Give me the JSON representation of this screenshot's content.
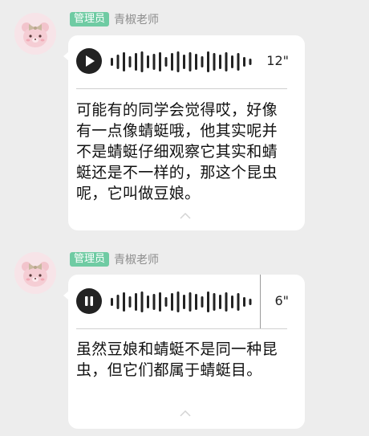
{
  "colors": {
    "background": "#ededed",
    "badge": "#6fcba3",
    "bubble": "#ffffff",
    "sender": "#8d8d8d"
  },
  "messages": [
    {
      "badge": "管理员",
      "sender": "青椒老师",
      "voice": {
        "state": "paused",
        "icon": "play-icon",
        "duration": "12\""
      },
      "transcript": "可能有的同学会觉得哎，好像有一点像蜻蜓哦，他其实呢并不是蜻蜓仔细观察它其实和蜻蜓还是不一样的，那这个昆虫呢，它叫做豆娘。",
      "collapse_icon": "chevron-up-icon"
    },
    {
      "badge": "管理员",
      "sender": "青椒老师",
      "voice": {
        "state": "playing",
        "icon": "pause-icon",
        "duration": "6\"",
        "progress": 0.97
      },
      "transcript": "虽然豆娘和蜻蜓不是同一种昆虫，但它们都属于蜻蜓目。",
      "collapse_icon": "chevron-up-icon"
    }
  ]
}
